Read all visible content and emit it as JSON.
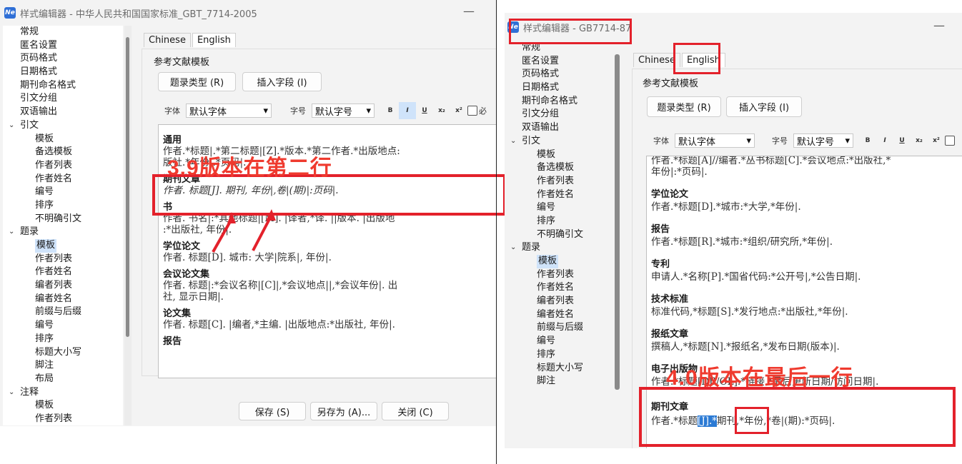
{
  "left": {
    "title": "样式编辑器 - 中华人民共和国国家标准_GBT_7714-2005",
    "app_icon": "Ne",
    "tree": [
      {
        "label": "常规",
        "level": 0
      },
      {
        "label": "匿名设置",
        "level": 0
      },
      {
        "label": "页码格式",
        "level": 0
      },
      {
        "label": "日期格式",
        "level": 0
      },
      {
        "label": "期刊命名格式",
        "level": 0
      },
      {
        "label": "引文分组",
        "level": 0
      },
      {
        "label": "双语输出",
        "level": 0
      },
      {
        "label": "引文",
        "level": 0,
        "expanded": true
      },
      {
        "label": "模板",
        "level": 1
      },
      {
        "label": "备选模板",
        "level": 1
      },
      {
        "label": "作者列表",
        "level": 1
      },
      {
        "label": "作者姓名",
        "level": 1
      },
      {
        "label": "编号",
        "level": 1
      },
      {
        "label": "排序",
        "level": 1
      },
      {
        "label": "不明确引文",
        "level": 1
      },
      {
        "label": "题录",
        "level": 0,
        "expanded": true
      },
      {
        "label": "模板",
        "level": 1,
        "selected": true
      },
      {
        "label": "作者列表",
        "level": 1
      },
      {
        "label": "作者姓名",
        "level": 1
      },
      {
        "label": "编者列表",
        "level": 1
      },
      {
        "label": "编者姓名",
        "level": 1
      },
      {
        "label": "前缀与后缀",
        "level": 1
      },
      {
        "label": "编号",
        "level": 1
      },
      {
        "label": "排序",
        "level": 1
      },
      {
        "label": "标题大小写",
        "level": 1
      },
      {
        "label": "脚注",
        "level": 1
      },
      {
        "label": "布局",
        "level": 1
      },
      {
        "label": "注释",
        "level": 0,
        "expanded": true
      },
      {
        "label": "模板",
        "level": 1
      },
      {
        "label": "作者列表",
        "level": 1
      }
    ],
    "tabs": [
      "Chinese",
      "English"
    ],
    "group_label": "参考文献模板",
    "btn_type": "题录类型 (R)",
    "btn_insert": "插入字段 (I)",
    "font_label": "字体",
    "font_value": "默认字体",
    "size_label": "字号",
    "size_value": "默认字号",
    "fmt": [
      "B",
      "I",
      "U",
      "x₂",
      "x²"
    ],
    "check_label": "必",
    "entries": [
      {
        "title": "通用",
        "lines": [
          "作者.*标题|.*第二标题|[Z].*版本.*第二作者.*出版地点:",
          "版社.*年份|.*页码|."
        ]
      },
      {
        "title": "期刊文章",
        "lines": [
          "作者. 标题[J]. 期刊, 年份|,卷|(期)|:页码|."
        ]
      },
      {
        "title": "书",
        "lines": [
          "作者. 书名|:*其他标题|[M]. |译者,*译. ||版本. |出版地",
          ":*出版社, 年份|."
        ]
      },
      {
        "title": "学位论文",
        "lines": [
          "作者. 标题[D]. 城市: 大学|院系|, 年份|."
        ]
      },
      {
        "title": "会议论文集",
        "lines": [
          "作者. 标题|:*会议名称|[C]|,*会议地点||,*会议年份|. 出",
          "社, 显示日期|."
        ]
      },
      {
        "title": "论文集",
        "lines": [
          "作者. 标题[C]. |编者,*主编. |出版地点:*出版社, 年份|."
        ]
      },
      {
        "title": "报告",
        "lines": []
      }
    ],
    "footer": [
      "保存 (S)",
      "另存为 (A)...",
      "关闭 (C)"
    ],
    "annotation": "3.9版本在第二行"
  },
  "right": {
    "title": "样式编辑器 - GB7714-87",
    "app_icon": "Ne",
    "tree": [
      {
        "label": "常规",
        "level": 0
      },
      {
        "label": "匿名设置",
        "level": 0
      },
      {
        "label": "页码格式",
        "level": 0
      },
      {
        "label": "日期格式",
        "level": 0
      },
      {
        "label": "期刊命名格式",
        "level": 0
      },
      {
        "label": "引文分组",
        "level": 0
      },
      {
        "label": "双语输出",
        "level": 0
      },
      {
        "label": "引文",
        "level": 0,
        "expanded": true
      },
      {
        "label": "模板",
        "level": 1
      },
      {
        "label": "备选模板",
        "level": 1
      },
      {
        "label": "作者列表",
        "level": 1
      },
      {
        "label": "作者姓名",
        "level": 1
      },
      {
        "label": "编号",
        "level": 1
      },
      {
        "label": "排序",
        "level": 1
      },
      {
        "label": "不明确引文",
        "level": 1
      },
      {
        "label": "题录",
        "level": 0,
        "expanded": true
      },
      {
        "label": "模板",
        "level": 1,
        "selected": true
      },
      {
        "label": "作者列表",
        "level": 1
      },
      {
        "label": "作者姓名",
        "level": 1
      },
      {
        "label": "编者列表",
        "level": 1
      },
      {
        "label": "编者姓名",
        "level": 1
      },
      {
        "label": "前缀与后缀",
        "level": 1
      },
      {
        "label": "编号",
        "level": 1
      },
      {
        "label": "排序",
        "level": 1
      },
      {
        "label": "标题大小写",
        "level": 1
      },
      {
        "label": "脚注",
        "level": 1
      }
    ],
    "tabs": [
      "Chinese",
      "English"
    ],
    "group_label": "参考文献模板",
    "btn_type": "题录类型 (R)",
    "btn_insert": "插入字段 (I)",
    "font_label": "字体",
    "font_value": "默认字体",
    "size_label": "字号",
    "size_value": "默认字号",
    "fmt": [
      "B",
      "I",
      "U",
      "x₂",
      "x²"
    ],
    "top_partial": "作者.*标题[A]//编者.*丛书标题[C].*会议地点:*出版社,*",
    "top_partial2": "年份|:*页码|.",
    "entries": [
      {
        "title": "学位论文",
        "line": "作者.*标题[D].*城市:*大学,*年份|."
      },
      {
        "title": "报告",
        "line": "作者.*标题[R].*城市:*组织/研究所,*年份|."
      },
      {
        "title": "专利",
        "line": "申请人.*名称[P].*国省代码:*公开号|,*公告日期|."
      },
      {
        "title": "技术标准",
        "line": "标准代码,*标题[S].*发行地点:*出版社,*年份|."
      },
      {
        "title": "报纸文章",
        "line": "撰稿人,*标题[N].*报纸名,*发布日期(版本)|."
      },
      {
        "title": "电子出版物",
        "line": "作者.*标题[DB/OL].*链接.*最后更新日期/访问日期|."
      }
    ],
    "journal_title": "期刊文章",
    "journal_pre": "作者.*标题",
    "journal_hl": "[J].*",
    "journal_box": "期刊",
    "journal_post": ",*年份,*卷|(期):*页码|.",
    "annotation": "4.0版本在最后一行"
  },
  "colors": {
    "annotation_red": "#e3212b",
    "selection": "#cfe3fa",
    "highlight": "#2b7ad4"
  }
}
